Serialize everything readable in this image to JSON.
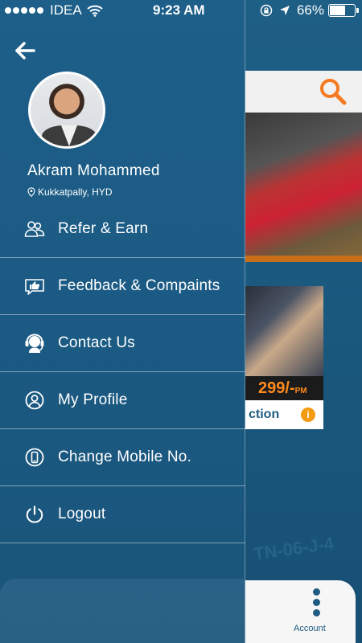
{
  "status_bar": {
    "carrier": "IDEA",
    "time": "9:23 AM",
    "battery": "66%",
    "battery_level": 0.66
  },
  "drawer": {
    "user": {
      "name": "Akram Mohammed",
      "location": "Kukkatpally, HYD"
    },
    "menu": [
      {
        "label": "Refer & Earn",
        "icon": "people-icon"
      },
      {
        "label": "Feedback & Compaints",
        "icon": "thumbs-up-chat-icon"
      },
      {
        "label": "Contact Us",
        "icon": "headset-icon"
      },
      {
        "label": "My Profile",
        "icon": "user-circle-icon"
      },
      {
        "label": "Change Mobile No.",
        "icon": "mobile-icon"
      },
      {
        "label": "Logout",
        "icon": "power-icon"
      }
    ]
  },
  "background": {
    "price": "299/-",
    "price_suffix": "PM",
    "cta": "Car Inspection",
    "cta_visible": "ction",
    "account_label": "Account",
    "plate_text": "TN-06-J-4"
  },
  "colors": {
    "drawer_bg": "#1b5a83",
    "accent_orange": "#f47b20",
    "text": "#ffffff"
  }
}
